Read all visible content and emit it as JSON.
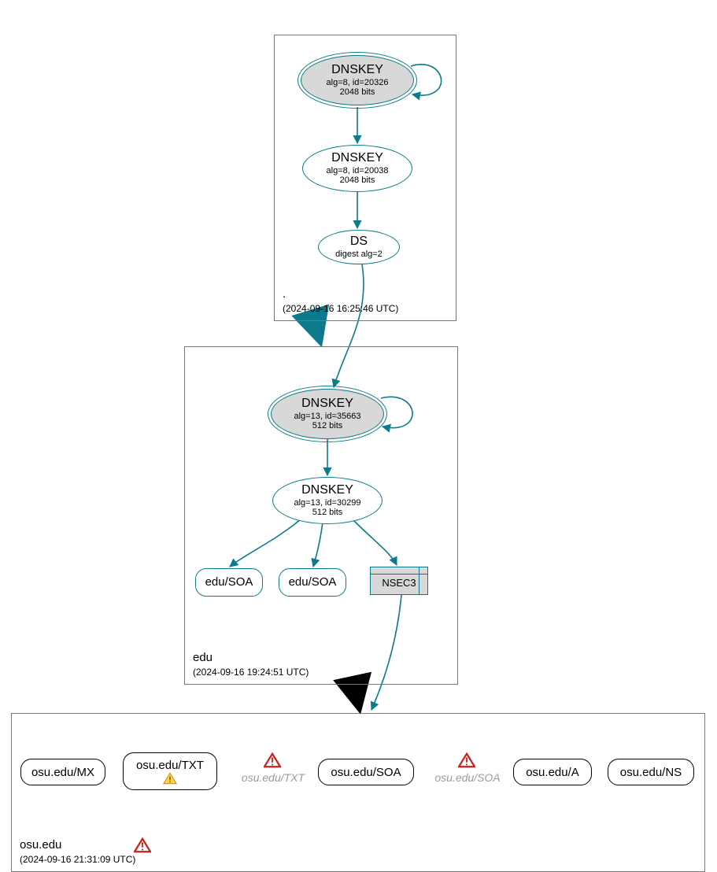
{
  "zones": {
    "root": {
      "name": ".",
      "timestamp": "(2024-09-16 16:25:46 UTC)",
      "ksk": {
        "title": "DNSKEY",
        "sub1": "alg=8, id=20326",
        "sub2": "2048 bits"
      },
      "zsk": {
        "title": "DNSKEY",
        "sub1": "alg=8, id=20038",
        "sub2": "2048 bits"
      },
      "ds": {
        "title": "DS",
        "sub1": "digest alg=2"
      }
    },
    "edu": {
      "name": "edu",
      "timestamp": "(2024-09-16 19:24:51 UTC)",
      "ksk": {
        "title": "DNSKEY",
        "sub1": "alg=13, id=35663",
        "sub2": "512 bits"
      },
      "zsk": {
        "title": "DNSKEY",
        "sub1": "alg=13, id=30299",
        "sub2": "512 bits"
      },
      "records": {
        "soa1": "edu/SOA",
        "soa2": "edu/SOA",
        "nsec3": "NSEC3"
      }
    },
    "osu": {
      "name": "osu.edu",
      "timestamp": "(2024-09-16 21:31:09 UTC)",
      "records": {
        "mx": "osu.edu/MX",
        "txt": "osu.edu/TXT",
        "txt_ghost": "osu.edu/TXT",
        "soa": "osu.edu/SOA",
        "soa_ghost": "osu.edu/SOA",
        "a": "osu.edu/A",
        "ns": "osu.edu/NS"
      }
    }
  },
  "colors": {
    "teal": "#0b7a8a",
    "grey_fill": "#d8d8d8",
    "ghost_text": "#9b9b9b"
  }
}
